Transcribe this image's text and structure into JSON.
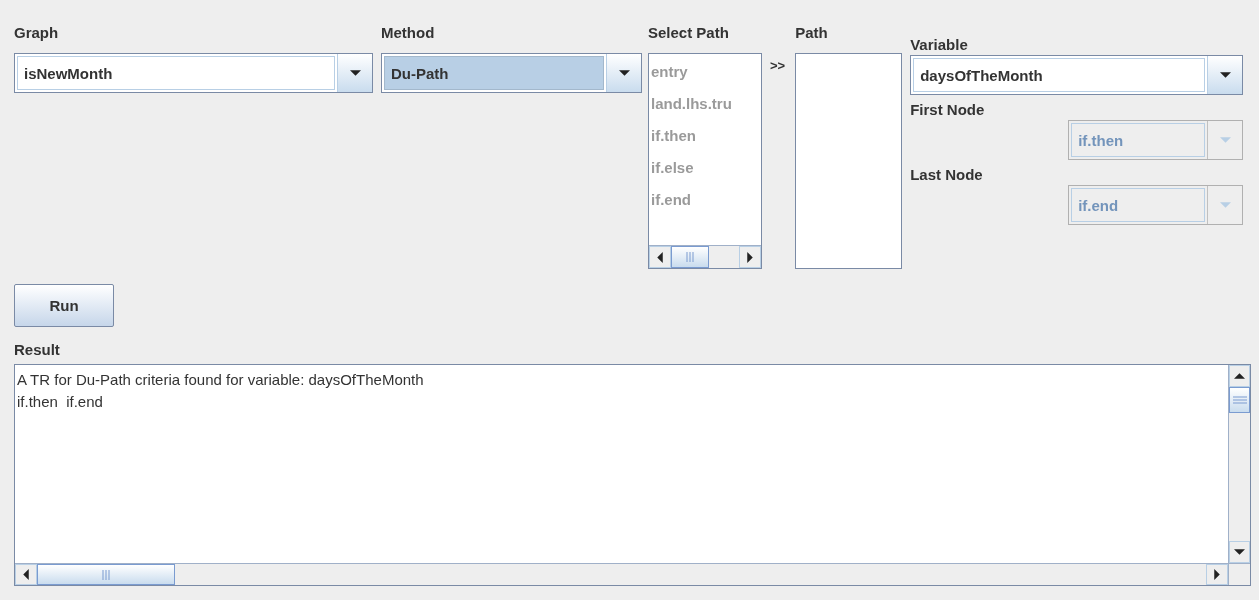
{
  "graph": {
    "label": "Graph",
    "value": "isNewMonth",
    "highlighted": false,
    "disabled": false
  },
  "method": {
    "label": "Method",
    "value": "Du-Path",
    "highlighted": true,
    "disabled": false
  },
  "select_path": {
    "label": "Select Path",
    "disabled": true,
    "items": [
      "entry",
      "land.lhs.tru",
      "if.then",
      "if.else",
      "if.end"
    ]
  },
  "move_button": ">>",
  "path": {
    "label": "Path"
  },
  "variable": {
    "label": "Variable",
    "value": "daysOfTheMonth",
    "highlighted": false,
    "disabled": false
  },
  "first_node": {
    "label": "First Node",
    "value": "if.then",
    "disabled": true
  },
  "last_node": {
    "label": "Last Node",
    "value": "if.end",
    "disabled": true
  },
  "run_button": "Run",
  "result": {
    "label": "Result",
    "lines": [
      "A TR for Du-Path criteria found for variable: daysOfTheMonth",
      "if.then  if.end"
    ]
  }
}
